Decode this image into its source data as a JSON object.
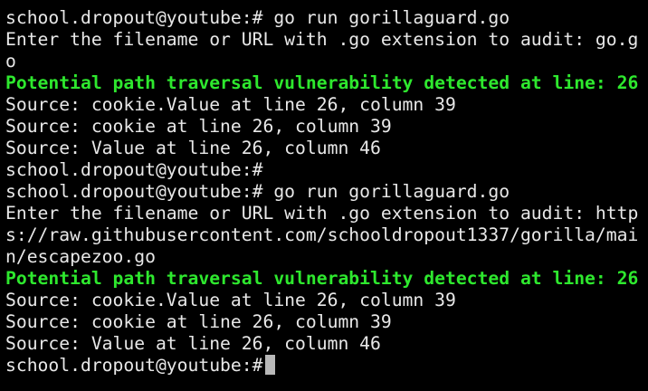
{
  "terminal": {
    "colors": {
      "background": "#000000",
      "text": "#e8e8e8",
      "alert": "#2ee82e",
      "cursor": "#b8b8b8"
    },
    "lines": [
      "school.dropout@youtube:# go run gorillaguard.go",
      "Enter the filename or URL with .go extension to audit: go.g",
      "o",
      "Potential path traversal vulnerability detected at line: 26",
      "Source: cookie.Value at line 26, column 39",
      "Source: cookie at line 26, column 39",
      "Source: Value at line 26, column 46",
      "school.dropout@youtube:#",
      "school.dropout@youtube:# go run gorillaguard.go",
      "Enter the filename or URL with .go extension to audit: http",
      "s://raw.githubusercontent.com/schooldropout1337/gorilla/mai",
      "n/escapezoo.go",
      "Potential path traversal vulnerability detected at line: 26",
      "Source: cookie.Value at line 26, column 39",
      "Source: cookie at line 26, column 39",
      "Source: Value at line 26, column 46"
    ],
    "prompt": "school.dropout@youtube:#"
  }
}
